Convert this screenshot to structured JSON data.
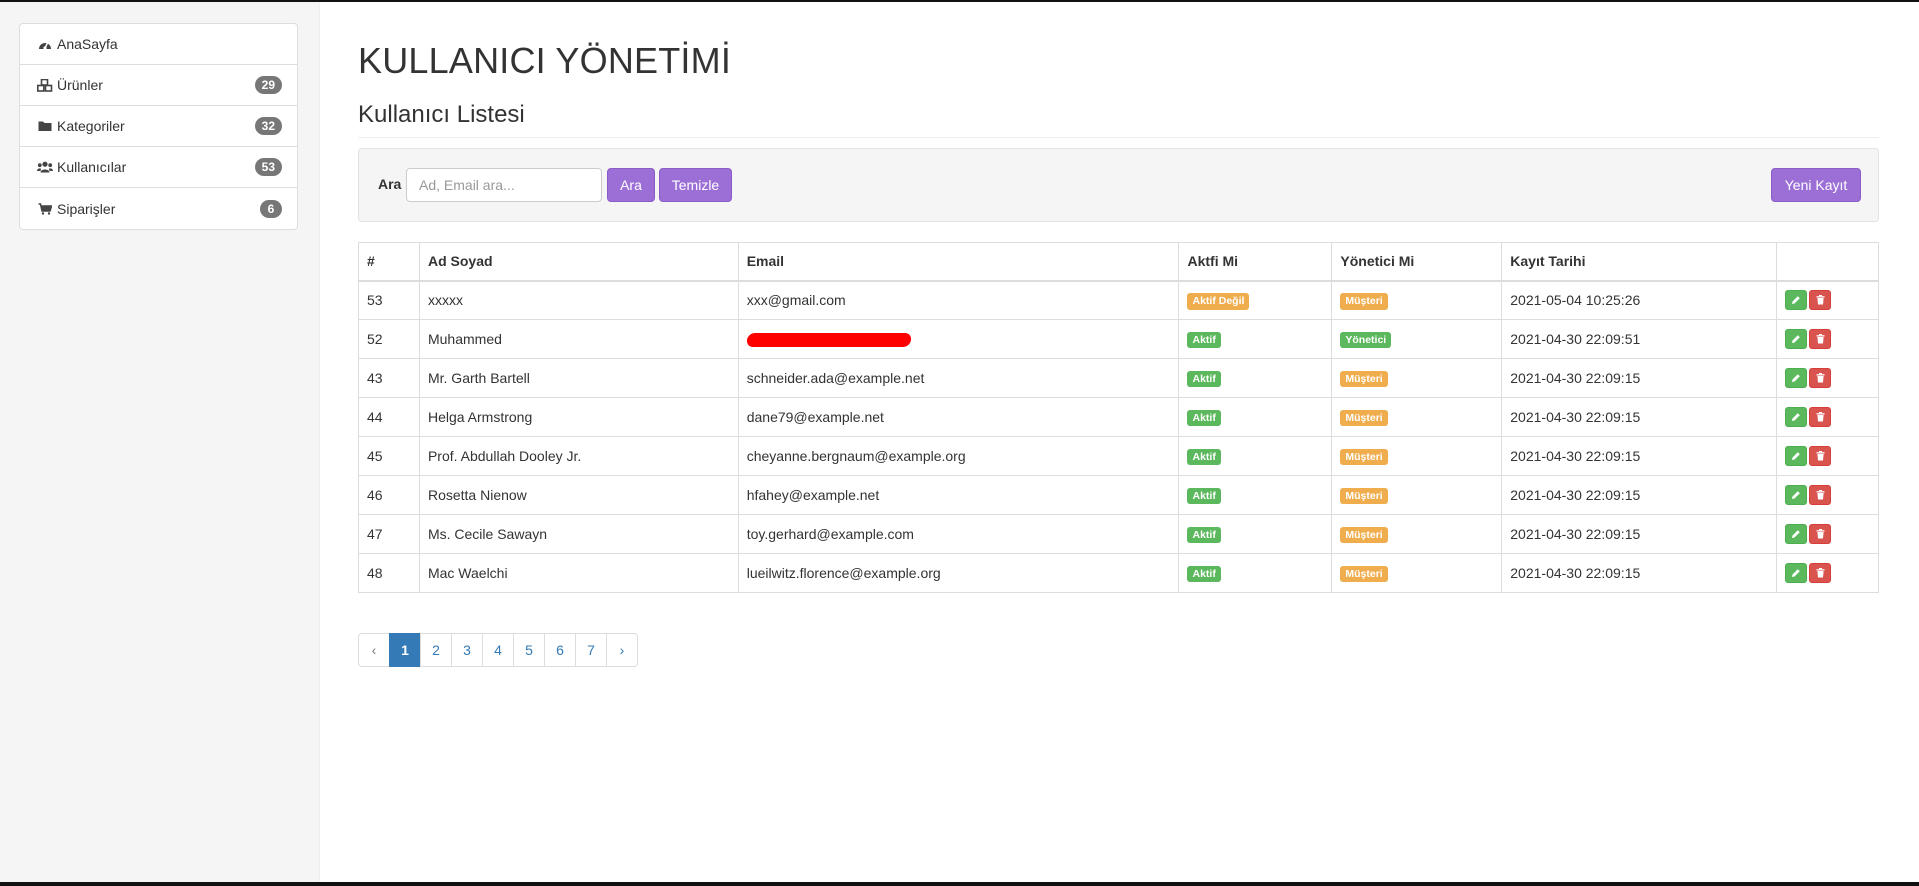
{
  "sidebar": {
    "items": [
      {
        "label": "AnaSayfa",
        "icon": "dashboard-icon",
        "badge": ""
      },
      {
        "label": "Ürünler",
        "icon": "cubes-icon",
        "badge": "29"
      },
      {
        "label": "Kategoriler",
        "icon": "folder-icon",
        "badge": "32"
      },
      {
        "label": "Kullanıcılar",
        "icon": "users-icon",
        "badge": "53"
      },
      {
        "label": "Siparişler",
        "icon": "cart-icon",
        "badge": "6"
      }
    ]
  },
  "page": {
    "title": "KULLANICI YÖNETİMİ",
    "subtitle": "Kullanıcı Listesi"
  },
  "search": {
    "label": "Ara",
    "placeholder": "Ad, Email ara...",
    "search_button": "Ara",
    "clear_button": "Temizle",
    "new_button": "Yeni Kayıt"
  },
  "table": {
    "headers": [
      "#",
      "Ad Soyad",
      "Email",
      "Aktfi Mi",
      "Yönetici Mi",
      "Kayıt Tarihi",
      ""
    ],
    "rows": [
      {
        "id": "53",
        "name": "xxxxx",
        "email": "xxx@gmail.com",
        "active": "Aktif Değil",
        "admin": "Müşteri",
        "date": "2021-05-04 10:25:26"
      },
      {
        "id": "52",
        "name": "Muhammed",
        "email": "",
        "active": "Aktif",
        "admin": "Yönetici",
        "date": "2021-04-30 22:09:51"
      },
      {
        "id": "43",
        "name": "Mr. Garth Bartell",
        "email": "schneider.ada@example.net",
        "active": "Aktif",
        "admin": "Müşteri",
        "date": "2021-04-30 22:09:15"
      },
      {
        "id": "44",
        "name": "Helga Armstrong",
        "email": "dane79@example.net",
        "active": "Aktif",
        "admin": "Müşteri",
        "date": "2021-04-30 22:09:15"
      },
      {
        "id": "45",
        "name": "Prof. Abdullah Dooley Jr.",
        "email": "cheyanne.bergnaum@example.org",
        "active": "Aktif",
        "admin": "Müşteri",
        "date": "2021-04-30 22:09:15"
      },
      {
        "id": "46",
        "name": "Rosetta Nienow",
        "email": "hfahey@example.net",
        "active": "Aktif",
        "admin": "Müşteri",
        "date": "2021-04-30 22:09:15"
      },
      {
        "id": "47",
        "name": "Ms. Cecile Sawayn",
        "email": "toy.gerhard@example.com",
        "active": "Aktif",
        "admin": "Müşteri",
        "date": "2021-04-30 22:09:15"
      },
      {
        "id": "48",
        "name": "Mac Waelchi",
        "email": "lueilwitz.florence@example.org",
        "active": "Aktif",
        "admin": "Müşteri",
        "date": "2021-04-30 22:09:15"
      }
    ]
  },
  "pagination": {
    "prev": "‹",
    "pages": [
      "1",
      "2",
      "3",
      "4",
      "5",
      "6",
      "7"
    ],
    "current": "1",
    "next": "›"
  },
  "colors": {
    "accent_purple": "#9c6fd6",
    "success": "#5cb85c",
    "warning": "#f0ad4e",
    "danger": "#d9534f",
    "primary": "#337ab7"
  }
}
